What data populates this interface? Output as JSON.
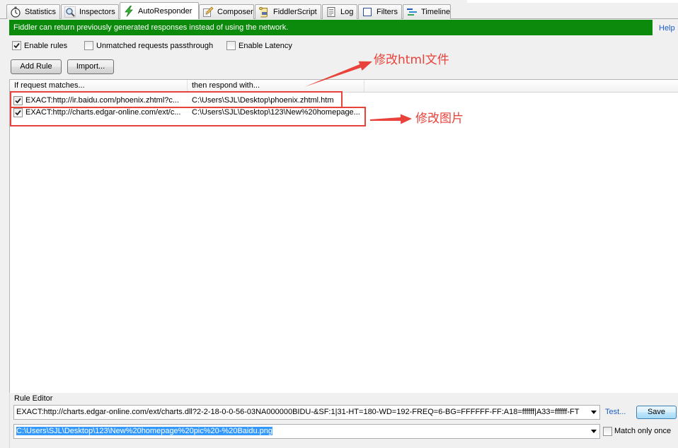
{
  "theme": {
    "banner_bg": "#0b8a0b",
    "annotation_red": "#e8423a",
    "link_blue": "#1c5cc7",
    "selection_bg": "#3399ff"
  },
  "tabs": [
    {
      "label": "Statistics",
      "icon": "stopwatch-icon",
      "active": false
    },
    {
      "label": "Inspectors",
      "icon": "magnifier-icon",
      "active": false
    },
    {
      "label": "AutoResponder",
      "icon": "lightning-icon",
      "active": true
    },
    {
      "label": "Composer",
      "icon": "composer-pencil-icon",
      "active": false
    },
    {
      "label": "FiddlerScript",
      "icon": "script-scroll-icon",
      "active": false
    },
    {
      "label": "Log",
      "icon": "log-document-icon",
      "active": false
    },
    {
      "label": "Filters",
      "icon": "filter-box-icon",
      "active": false
    },
    {
      "label": "Timeline",
      "icon": "timeline-bars-icon",
      "active": false
    }
  ],
  "banner": {
    "text": "Fiddler can return previously generated responses instead of using the network."
  },
  "help_label": "Help",
  "options": {
    "enable_rules": {
      "label": "Enable rules",
      "checked": true
    },
    "unmatched_passthrough": {
      "label": "Unmatched requests passthrough",
      "checked": false
    },
    "enable_latency": {
      "label": "Enable Latency",
      "checked": false
    }
  },
  "toolbar": {
    "add_rule_label": "Add Rule",
    "import_label": "Import..."
  },
  "rules_table": {
    "columns": [
      "If request matches...",
      "then respond with..."
    ],
    "rows": [
      {
        "enabled": true,
        "match": "EXACT:http://ir.baidu.com/phoenix.zhtml?c...",
        "respond": "C:\\Users\\SJL\\Desktop\\phoenix.zhtml.htm"
      },
      {
        "enabled": true,
        "match": "EXACT:http://charts.edgar-online.com/ext/c...",
        "respond": "C:\\Users\\SJL\\Desktop\\123\\New%20homepage..."
      }
    ]
  },
  "annotations": [
    {
      "text": "修改html文件"
    },
    {
      "text": "修改图片"
    }
  ],
  "rule_editor": {
    "title": "Rule Editor",
    "match_value": "EXACT:http://charts.edgar-online.com/ext/charts.dll?2-2-18-0-0-56-03NA000000BIDU-&SF:1|31-HT=180-WD=192-FREQ=6-BG=FFFFFF-FF:A18=ffffff|A33=ffffff-FT",
    "test_label": "Test...",
    "save_label": "Save",
    "respond_value": "C:\\Users\\SJL\\Desktop\\123\\New%20homepage%20pic%20-%20Baidu.png",
    "match_once": {
      "label": "Match only once",
      "checked": false
    }
  }
}
